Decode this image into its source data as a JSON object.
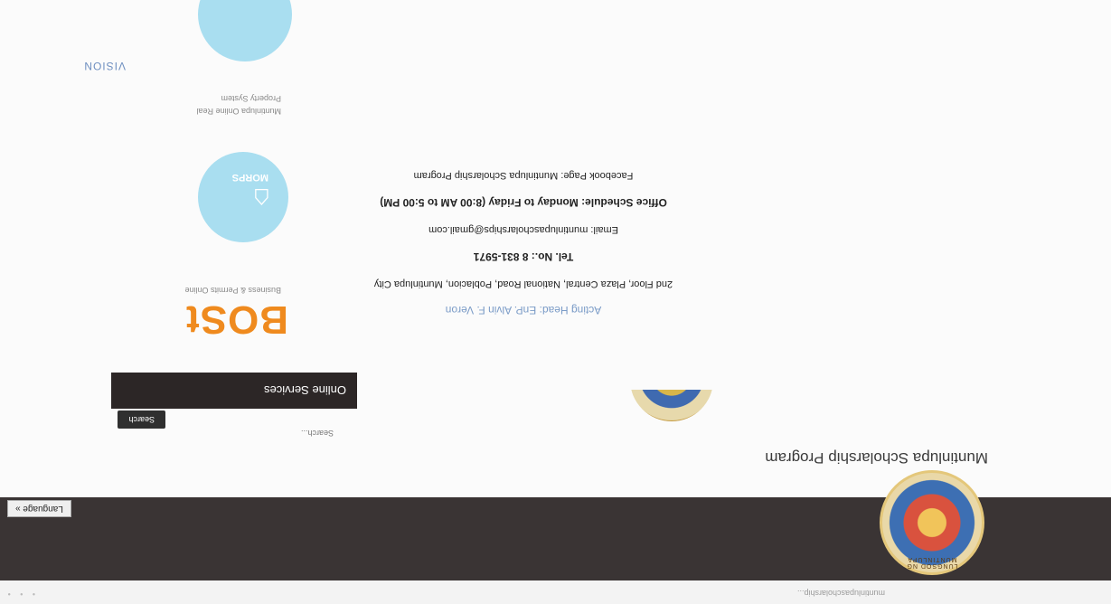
{
  "browser": {
    "url_text": "muntinlupascholarship...",
    "nav_dots": "• • •"
  },
  "header": {
    "seal_text": "LUNGSOD NG MUNTINLUPA",
    "language_label": "Language »"
  },
  "site": {
    "title": "Muntinlupa Scholarship Program"
  },
  "contact": {
    "acting_head": "Acting Head: EnP. Alvin F. Veron",
    "address": "2nd Floor, Plaza Central, National Road, Poblacion, Muntinlupa City",
    "tel": "Tel. No.: 8 831-5971",
    "email": "Email: muntinlupascholarships@gmail.com",
    "schedule": "Office Schedule: Monday to Friday (8:00 AM to 5:00 PM)",
    "facebook": "Facebook Page: Muntinlupa Scholarship Program"
  },
  "vision_label": "VISION",
  "sidebar": {
    "search_placeholder": "Search...",
    "search_button": "Search",
    "services_title": "Online Services",
    "bost_logo": "BOSt",
    "bost_caption": "Business & Permits Online",
    "morps_label": "MORPS",
    "morps_caption": "Muntinlupa Online Real Property System"
  },
  "colors": {
    "header_bg": "#3a3434",
    "accent_blue": "#7a9bc7",
    "bost_orange": "#ef8a1e",
    "morps_blue": "#a9def0"
  }
}
